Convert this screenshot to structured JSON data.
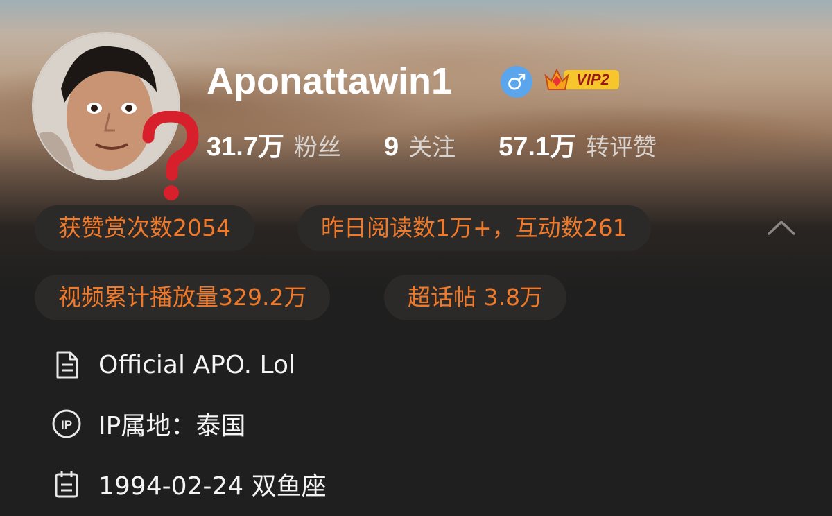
{
  "profile": {
    "username": "Aponattawin1",
    "gender_symbol": "♂",
    "vip_label": "VIP2",
    "stats": [
      {
        "value": "31.7万",
        "label": "粉丝"
      },
      {
        "value": "9",
        "label": "关注"
      },
      {
        "value": "57.1万",
        "label": "转评赞"
      }
    ]
  },
  "chips": {
    "reward": "获赞赏次数2054",
    "yesterday": "昨日阅读数1万+，互动数261",
    "video": "视频累计播放量329.2万",
    "supertopic": "超话帖 3.8万"
  },
  "info": {
    "bio": "Official APO. Lol",
    "ip": "IP属地：泰国",
    "birthday": "1994-02-24 双鱼座"
  },
  "icons": {
    "bio": "document-icon",
    "ip": "ip-location-icon",
    "birthday": "calendar-icon",
    "collapse": "chevron-up-icon"
  },
  "colors": {
    "accent": "#f07a2a",
    "gender_badge": "#5aa5ec",
    "background": "#1f1f1f",
    "chip_bg": "#2c2a29",
    "question_mark": "#d8202c"
  }
}
